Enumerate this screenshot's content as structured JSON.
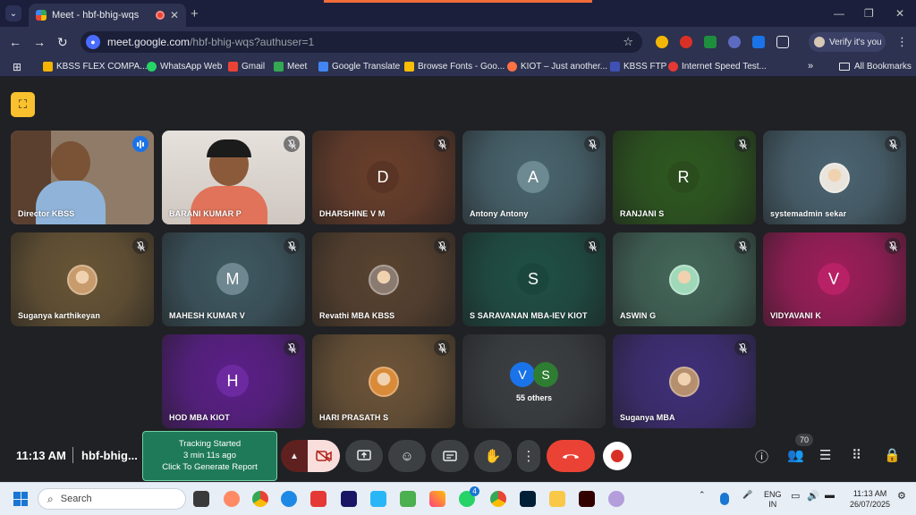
{
  "browser": {
    "tab_title": "Meet - hbf-bhig-wqs",
    "new_tab": "+",
    "url_host": "meet.google.com",
    "url_path": "/hbf-bhig-wqs?authuser=1",
    "verify_label": "Verify it's you"
  },
  "bookmarks": [
    {
      "label": "KBSS FLEX COMPA...",
      "color": "#f4b400"
    },
    {
      "label": "WhatsApp Web",
      "color": "#25d366"
    },
    {
      "label": "Gmail",
      "color": "#ea4335"
    },
    {
      "label": "Meet",
      "color": "#34a853"
    },
    {
      "label": "Google Translate",
      "color": "#4285f4"
    },
    {
      "label": "Browse Fonts - Goo...",
      "color": "#fbbc04"
    },
    {
      "label": "KIOT – Just another...",
      "color": "#ff7043"
    },
    {
      "label": "KBSS FTP",
      "color": "#3f51b5"
    },
    {
      "label": "Internet Speed Test...",
      "color": "#e53935"
    }
  ],
  "bookmarks_all": "All Bookmarks",
  "participants": [
    {
      "name": "Director KBSS",
      "type": "video",
      "bg": "#8a7a6a"
    },
    {
      "name": "BARANI KUMAR P",
      "type": "video",
      "bg": "#d9d4cf"
    },
    {
      "name": "DHARSHINE V M",
      "type": "letter",
      "letter": "D",
      "bg": "#6b3f2b",
      "avatar": "#5a3425"
    },
    {
      "name": "Antony Antony",
      "type": "letter",
      "letter": "A",
      "bg": "#4a6670",
      "avatar": "#6d8991"
    },
    {
      "name": "RANJANI S",
      "type": "letter",
      "letter": "R",
      "bg": "#2e5a1f",
      "avatar": "#2b4d1d"
    },
    {
      "name": "systemadmin sekar",
      "type": "photo",
      "bg": "#4c6673",
      "avatar": "#e9e4dc"
    },
    {
      "name": "Suganya karthikeyan",
      "type": "photo",
      "bg": "#6a5636",
      "avatar": "#c79b6b"
    },
    {
      "name": "MAHESH KUMAR V",
      "type": "letter",
      "letter": "M",
      "bg": "#3f5962",
      "avatar": "#6e8790"
    },
    {
      "name": "Revathi MBA KBSS",
      "type": "photo",
      "bg": "#5a4330",
      "avatar": "#8a7a6f"
    },
    {
      "name": "S SARAVANAN MBA-IEV KIOT",
      "type": "letter",
      "letter": "S",
      "bg": "#1f5046",
      "avatar": "#1b463d"
    },
    {
      "name": "ASWIN G",
      "type": "photo",
      "bg": "#44685a",
      "avatar": "#9fd9b9"
    },
    {
      "name": "VIDYAVANI K",
      "type": "letter",
      "letter": "V",
      "bg": "#a01d5b",
      "avatar": "#b82166"
    },
    {
      "name": "HOD MBA KIOT",
      "type": "letter",
      "letter": "H",
      "bg": "#5c1f8a",
      "avatar": "#6d2aa0"
    },
    {
      "name": "HARI PRASATH S",
      "type": "photo",
      "bg": "#6e5538",
      "avatar": "#d98b3a"
    },
    {
      "name": "55 others",
      "type": "others",
      "bg": "#3c4043"
    },
    {
      "name": "Suganya MBA",
      "type": "photo",
      "bg": "#402f7a",
      "avatar": "#b58f6e"
    }
  ],
  "others": {
    "a": "V",
    "b": "S"
  },
  "meeting": {
    "time": "11:13 AM",
    "code": "hbf-bhig...",
    "tracking_title": "Tracking Started",
    "tracking_time": "3 min 11s ago",
    "tracking_action": "Click To Generate Report",
    "people_count": "70"
  },
  "taskbar": {
    "search_label": "Search",
    "lang": "ENG",
    "region": "IN",
    "time": "11:13 AM",
    "date": "26/07/2025",
    "whatsapp_badge": "4"
  }
}
